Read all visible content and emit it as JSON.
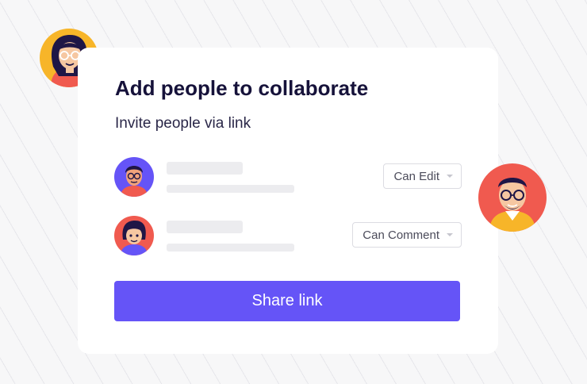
{
  "dialog": {
    "title": "Add people to collaborate",
    "subtitle": "Invite people via link"
  },
  "people": [
    {
      "permission": "Can Edit",
      "avatar": "man-glasses-avatar-icon"
    },
    {
      "permission": "Can Comment",
      "avatar": "woman-dark-hair-avatar-icon"
    }
  ],
  "share_button": {
    "label": "Share link"
  },
  "colors": {
    "accent": "#6554f7",
    "title": "#16123a",
    "skeleton": "#ececef",
    "card": "#ffffff"
  }
}
